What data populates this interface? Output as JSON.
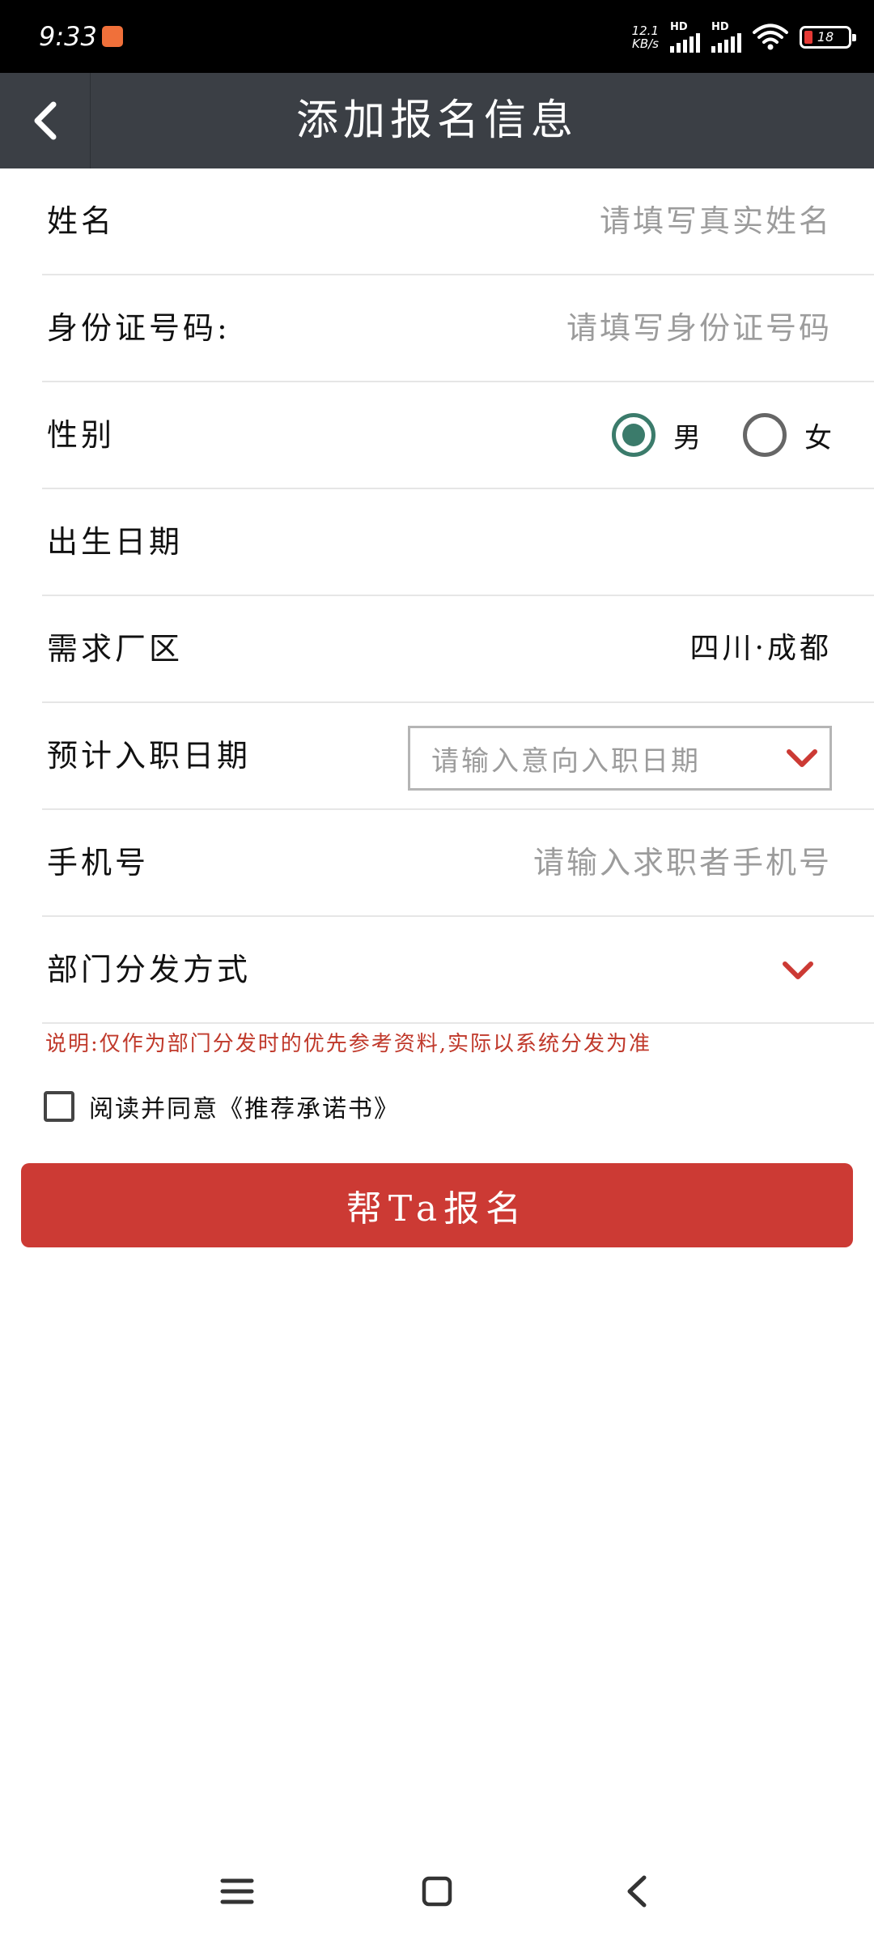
{
  "status_bar": {
    "time": "9:33",
    "net_speed_value": "12.1",
    "net_speed_unit": "KB/s",
    "sim1_label": "HD",
    "sim2_label": "HD",
    "battery_level": "18",
    "battery_color": "#e53935"
  },
  "header": {
    "title": "添加报名信息",
    "back_icon": "chevron-left-icon"
  },
  "form": {
    "name": {
      "label": "姓名",
      "placeholder": "请填写真实姓名"
    },
    "id_number": {
      "label": "身份证号码:",
      "placeholder": "请填写身份证号码"
    },
    "gender": {
      "label": "性别",
      "options": [
        {
          "label": "男",
          "checked": true
        },
        {
          "label": "女",
          "checked": false
        }
      ],
      "checked_color": "#3b7b6b"
    },
    "birth_date": {
      "label": "出生日期",
      "value": ""
    },
    "factory_area": {
      "label": "需求厂区",
      "value": "四川·成都"
    },
    "entry_date": {
      "label": "预计入职日期",
      "placeholder": "请输入意向入职日期"
    },
    "phone": {
      "label": "手机号",
      "placeholder": "请输入求职者手机号"
    },
    "dept_dispatch": {
      "label": "部门分发方式",
      "value": ""
    }
  },
  "note": "说明:仅作为部门分发时的优先参考资料,实际以系统分发为准",
  "agreement": {
    "text": "阅读并同意《推荐承诺书》",
    "checked": false
  },
  "submit_label": "帮Ta报名",
  "accent_color": "#cc3a34",
  "nav": {
    "menu_icon": "menu-icon",
    "home_icon": "home-square-icon",
    "back_icon": "back-triangle-icon"
  }
}
